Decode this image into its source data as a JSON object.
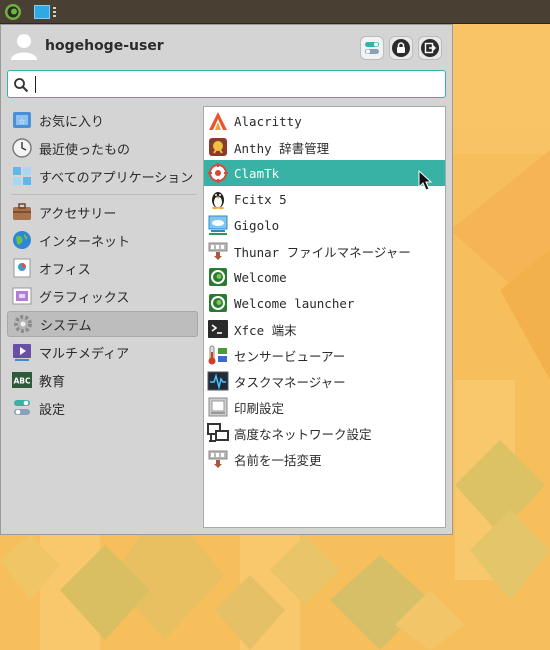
{
  "accent_color": "#38b2a5",
  "panel": {
    "whisker_icon": "xfce-mouse-logo-icon",
    "workspace_icon": "workspace-switcher-icon"
  },
  "menu": {
    "user": {
      "name": "hogehoge-user",
      "avatar_icon": "user-avatar-icon"
    },
    "header_buttons": [
      {
        "name": "settings-button",
        "icon": "toggle-settings-icon"
      },
      {
        "name": "lock-screen-button",
        "icon": "lock-icon"
      },
      {
        "name": "logout-button",
        "icon": "logout-icon"
      }
    ],
    "search": {
      "value": "",
      "placeholder": "",
      "icon": "search-icon"
    },
    "categories": [
      {
        "label": "お気に入り",
        "icon": "favorites-icon"
      },
      {
        "label": "最近使ったもの",
        "icon": "clock-icon"
      },
      {
        "label": "すべてのアプリケーション",
        "icon": "all-apps-icon"
      },
      {
        "label": "アクセサリー",
        "icon": "briefcase-icon"
      },
      {
        "label": "インターネット",
        "icon": "globe-icon"
      },
      {
        "label": "オフィス",
        "icon": "office-icon"
      },
      {
        "label": "グラフィックス",
        "icon": "graphics-icon"
      },
      {
        "label": "システム",
        "icon": "gear-icon",
        "selected": true
      },
      {
        "label": "マルチメディア",
        "icon": "multimedia-icon"
      },
      {
        "label": "教育",
        "icon": "education-icon"
      },
      {
        "label": "設定",
        "icon": "settings-icon"
      }
    ],
    "apps": [
      {
        "label": "Alacritty",
        "icon": "alacritty-icon"
      },
      {
        "label": "Anthy 辞書管理",
        "icon": "anthy-dictionary-icon"
      },
      {
        "label": "ClamTk",
        "icon": "clamtk-icon",
        "selected": true
      },
      {
        "label": "Fcitx 5",
        "icon": "penguin-icon"
      },
      {
        "label": "Gigolo",
        "icon": "gigolo-icon"
      },
      {
        "label": "Thunar ファイルマネージャー",
        "icon": "bulk-rename-icon"
      },
      {
        "label": "Welcome",
        "icon": "welcome-icon"
      },
      {
        "label": "Welcome launcher",
        "icon": "welcome-icon"
      },
      {
        "label": "Xfce 端末",
        "icon": "terminal-icon"
      },
      {
        "label": "センサービューアー",
        "icon": "sensor-icon"
      },
      {
        "label": "タスクマネージャー",
        "icon": "task-manager-icon"
      },
      {
        "label": "印刷設定",
        "icon": "printer-icon"
      },
      {
        "label": "高度なネットワーク設定",
        "icon": "network-icon"
      },
      {
        "label": "名前を一括変更",
        "icon": "bulk-rename-icon"
      }
    ]
  }
}
